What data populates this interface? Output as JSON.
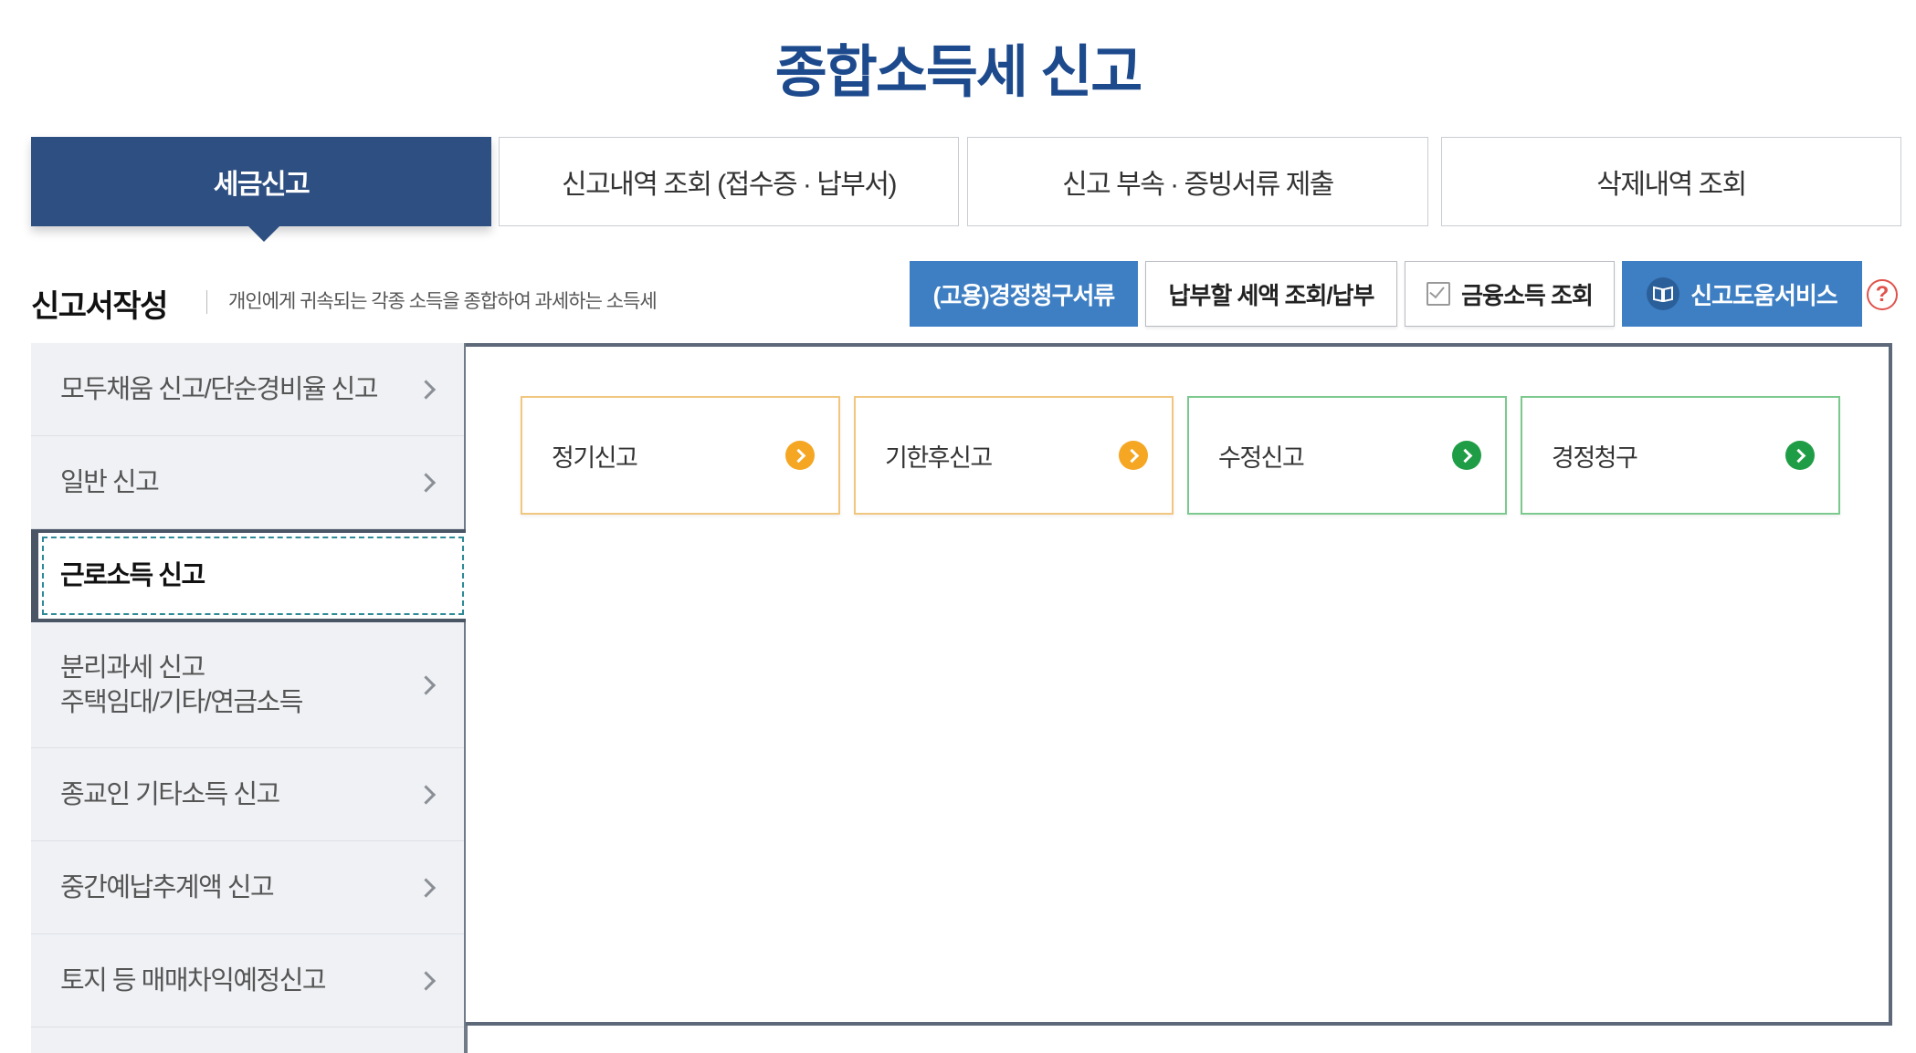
{
  "page": {
    "title": "종합소득세 신고"
  },
  "tabs": [
    {
      "label": "세금신고",
      "active": true
    },
    {
      "label": "신고내역 조회 (접수증 · 납부서)",
      "active": false
    },
    {
      "label": "신고 부속 · 증빙서류 제출",
      "active": false
    },
    {
      "label": "삭제내역 조회",
      "active": false
    }
  ],
  "section": {
    "title": "신고서작성",
    "description": "개인에게 귀속되는 각종 소득을 종합하여 과세하는 소득세"
  },
  "header_buttons": [
    {
      "label": "(고용)경정청구서류",
      "style": "blue",
      "icon": ""
    },
    {
      "label": "납부할 세액 조회/납부",
      "style": "white",
      "icon": ""
    },
    {
      "label": "금융소득 조회",
      "style": "white",
      "icon": "checkbox-icon"
    },
    {
      "label": "신고도움서비스",
      "style": "blue",
      "icon": "book-icon"
    }
  ],
  "help_icon": {
    "glyph": "?"
  },
  "menu": {
    "items": [
      {
        "label": "모두채움 신고/단순경비율 신고"
      },
      {
        "label": "일반 신고"
      },
      {
        "label": "근로소득 신고",
        "selected": true
      },
      {
        "label": "분리과세 신고",
        "label2": "주택임대/기타/연금소득"
      },
      {
        "label": "종교인 기타소득 신고"
      },
      {
        "label": "중간예납추계액 신고"
      },
      {
        "label": "토지 등 매매차익예정신고"
      }
    ]
  },
  "cards": [
    {
      "label": "정기신고",
      "color": "#f5a623"
    },
    {
      "label": "기한후신고",
      "color": "#f5a623"
    },
    {
      "label": "수정신고",
      "color": "#1f9d46"
    },
    {
      "label": "경정청구",
      "color": "#1f9d46"
    }
  ],
  "colors": {
    "primary": "#2d4f82",
    "title": "#1d4a8c",
    "button_blue": "#3e7fc4",
    "orange": "#f5a623",
    "green": "#1f9d46"
  }
}
